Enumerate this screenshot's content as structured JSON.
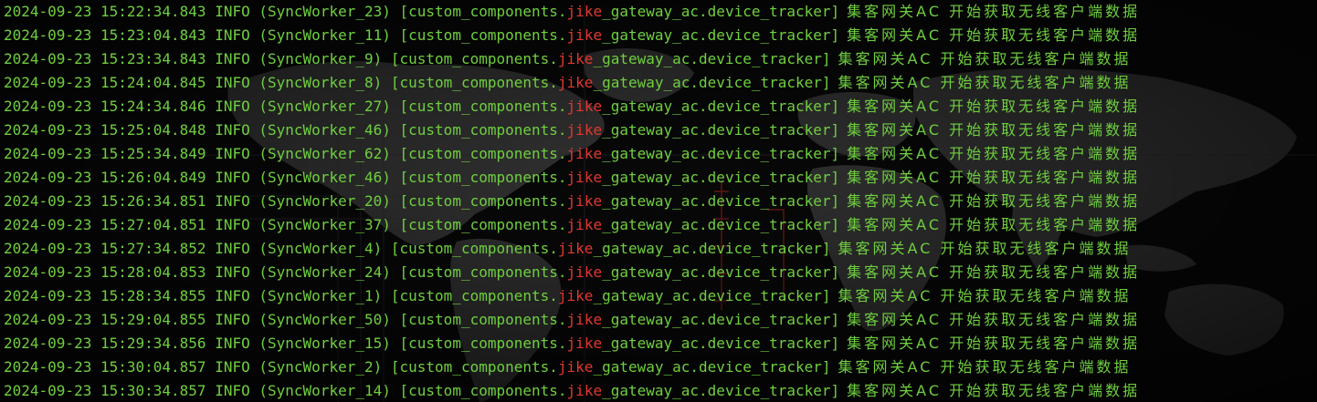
{
  "terminal": {
    "colors": {
      "background": "#080808",
      "text": "#6fcf3f",
      "highlight": "#e2372d",
      "map": "#4a4a4a"
    },
    "lines": [
      {
        "date": "2024-09-23",
        "time": "15:22:34.843",
        "level": "INFO",
        "worker": "(SyncWorker_23)",
        "prefix": "[custom_components.",
        "highlight": "jike",
        "suffix": "_gateway_ac.device_tracker]",
        "message": "集客网关AC 开始获取无线客户端数据"
      },
      {
        "date": "2024-09-23",
        "time": "15:23:04.843",
        "level": "INFO",
        "worker": "(SyncWorker_11)",
        "prefix": "[custom_components.",
        "highlight": "jike",
        "suffix": "_gateway_ac.device_tracker]",
        "message": "集客网关AC 开始获取无线客户端数据"
      },
      {
        "date": "2024-09-23",
        "time": "15:23:34.843",
        "level": "INFO",
        "worker": "(SyncWorker_9)",
        "prefix": "[custom_components.",
        "highlight": "jike",
        "suffix": "_gateway_ac.device_tracker]",
        "message": "集客网关AC 开始获取无线客户端数据"
      },
      {
        "date": "2024-09-23",
        "time": "15:24:04.845",
        "level": "INFO",
        "worker": "(SyncWorker_8)",
        "prefix": "[custom_components.",
        "highlight": "jike",
        "suffix": "_gateway_ac.device_tracker]",
        "message": "集客网关AC 开始获取无线客户端数据"
      },
      {
        "date": "2024-09-23",
        "time": "15:24:34.846",
        "level": "INFO",
        "worker": "(SyncWorker_27)",
        "prefix": "[custom_components.",
        "highlight": "jike",
        "suffix": "_gateway_ac.device_tracker]",
        "message": "集客网关AC 开始获取无线客户端数据"
      },
      {
        "date": "2024-09-23",
        "time": "15:25:04.848",
        "level": "INFO",
        "worker": "(SyncWorker_46)",
        "prefix": "[custom_components.",
        "highlight": "jike",
        "suffix": "_gateway_ac.device_tracker]",
        "message": "集客网关AC 开始获取无线客户端数据"
      },
      {
        "date": "2024-09-23",
        "time": "15:25:34.849",
        "level": "INFO",
        "worker": "(SyncWorker_62)",
        "prefix": "[custom_components.",
        "highlight": "jike",
        "suffix": "_gateway_ac.device_tracker]",
        "message": "集客网关AC 开始获取无线客户端数据"
      },
      {
        "date": "2024-09-23",
        "time": "15:26:04.849",
        "level": "INFO",
        "worker": "(SyncWorker_46)",
        "prefix": "[custom_components.",
        "highlight": "jike",
        "suffix": "_gateway_ac.device_tracker]",
        "message": "集客网关AC 开始获取无线客户端数据"
      },
      {
        "date": "2024-09-23",
        "time": "15:26:34.851",
        "level": "INFO",
        "worker": "(SyncWorker_20)",
        "prefix": "[custom_components.",
        "highlight": "jike",
        "suffix": "_gateway_ac.device_tracker]",
        "message": "集客网关AC 开始获取无线客户端数据"
      },
      {
        "date": "2024-09-23",
        "time": "15:27:04.851",
        "level": "INFO",
        "worker": "(SyncWorker_37)",
        "prefix": "[custom_components.",
        "highlight": "jike",
        "suffix": "_gateway_ac.device_tracker]",
        "message": "集客网关AC 开始获取无线客户端数据"
      },
      {
        "date": "2024-09-23",
        "time": "15:27:34.852",
        "level": "INFO",
        "worker": "(SyncWorker_4)",
        "prefix": "[custom_components.",
        "highlight": "jike",
        "suffix": "_gateway_ac.device_tracker]",
        "message": "集客网关AC 开始获取无线客户端数据"
      },
      {
        "date": "2024-09-23",
        "time": "15:28:04.853",
        "level": "INFO",
        "worker": "(SyncWorker_24)",
        "prefix": "[custom_components.",
        "highlight": "jike",
        "suffix": "_gateway_ac.device_tracker]",
        "message": "集客网关AC 开始获取无线客户端数据"
      },
      {
        "date": "2024-09-23",
        "time": "15:28:34.855",
        "level": "INFO",
        "worker": "(SyncWorker_1)",
        "prefix": "[custom_components.",
        "highlight": "jike",
        "suffix": "_gateway_ac.device_tracker]",
        "message": "集客网关AC 开始获取无线客户端数据"
      },
      {
        "date": "2024-09-23",
        "time": "15:29:04.855",
        "level": "INFO",
        "worker": "(SyncWorker_50)",
        "prefix": "[custom_components.",
        "highlight": "jike",
        "suffix": "_gateway_ac.device_tracker]",
        "message": "集客网关AC 开始获取无线客户端数据"
      },
      {
        "date": "2024-09-23",
        "time": "15:29:34.856",
        "level": "INFO",
        "worker": "(SyncWorker_15)",
        "prefix": "[custom_components.",
        "highlight": "jike",
        "suffix": "_gateway_ac.device_tracker]",
        "message": "集客网关AC 开始获取无线客户端数据"
      },
      {
        "date": "2024-09-23",
        "time": "15:30:04.857",
        "level": "INFO",
        "worker": "(SyncWorker_2)",
        "prefix": "[custom_components.",
        "highlight": "jike",
        "suffix": "_gateway_ac.device_tracker]",
        "message": "集客网关AC 开始获取无线客户端数据"
      },
      {
        "date": "2024-09-23",
        "time": "15:30:34.857",
        "level": "INFO",
        "worker": "(SyncWorker_14)",
        "prefix": "[custom_components.",
        "highlight": "jike",
        "suffix": "_gateway_ac.device_tracker]",
        "message": "集客网关AC 开始获取无线客户端数据"
      }
    ]
  }
}
